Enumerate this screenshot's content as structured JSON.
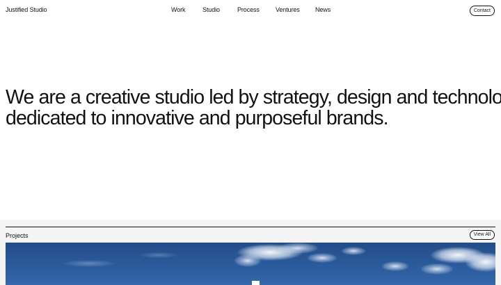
{
  "header": {
    "logo_text": "Justified Studio",
    "nav": {
      "work": "Work",
      "studio": "Studio",
      "process": "Process",
      "ventures": "Ventures",
      "news": "News"
    },
    "contact_label": "Contact"
  },
  "hero": {
    "line1": "We are a creative studio led by strategy, design and technology",
    "line2": "dedicated to innovative and purposeful brands."
  },
  "projects": {
    "title": "Projects",
    "view_all_label": "View All"
  },
  "colors": {
    "text": "#111111",
    "background": "#ffffff",
    "section_background": "#f4f4f4",
    "sky_blue": "#2a5a9c"
  }
}
